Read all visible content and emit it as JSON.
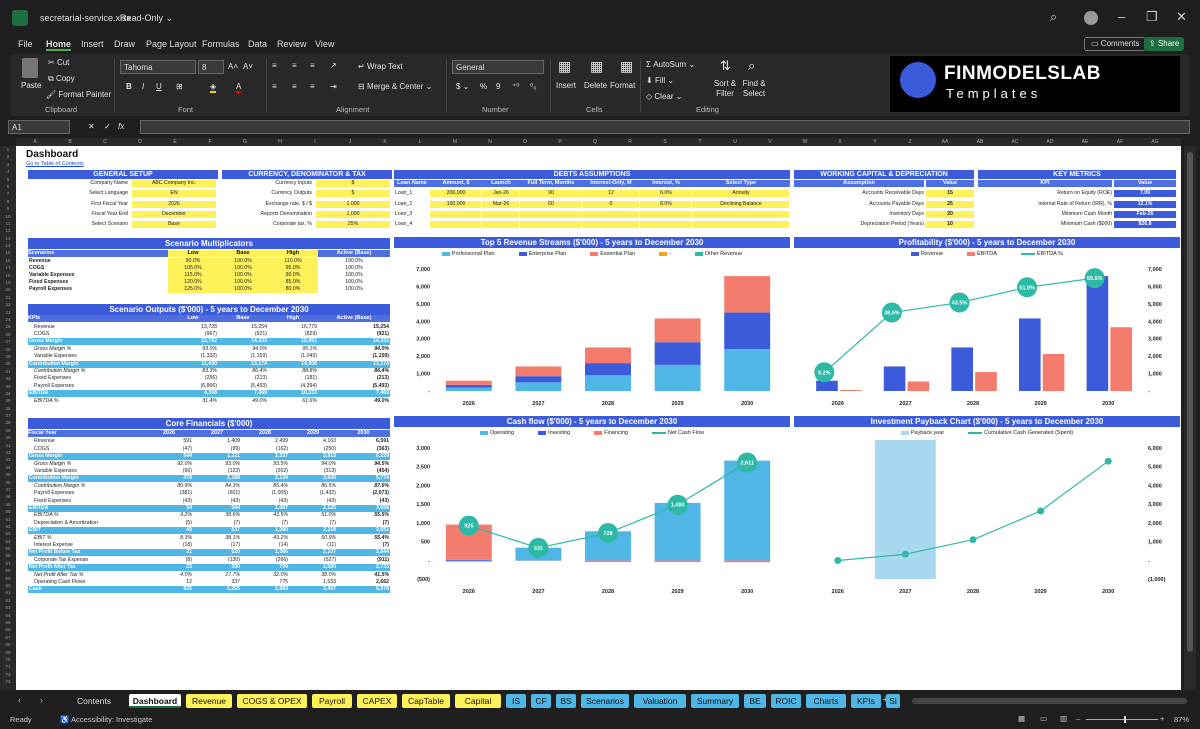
{
  "title": {
    "file": "secretarial-service.xlsx",
    "mode": "Read-Only"
  },
  "menu": [
    "File",
    "Home",
    "Insert",
    "Draw",
    "Page Layout",
    "Formulas",
    "Data",
    "Review",
    "View"
  ],
  "top_buttons": {
    "comments": "Comments",
    "share": "Share"
  },
  "ribbon": {
    "paste": "Paste",
    "cut": "Cut",
    "copy": "Copy",
    "format_painter": "Format Painter",
    "clipboard": "Clipboard",
    "font_name": "Tahoma",
    "font_size": "8",
    "font": "Font",
    "wrap": "Wrap Text",
    "merge": "Merge & Center",
    "alignment": "Alignment",
    "number_format": "General",
    "number": "Number",
    "insert": "Insert",
    "delete": "Delete",
    "format": "Format",
    "cells": "Cells",
    "autosum": "AutoSum",
    "fill": "Fill",
    "clear": "Clear",
    "sort": "Sort & Filter",
    "find": "Find & Select",
    "editing": "Editing"
  },
  "logo": {
    "name": "FINMODELSLAB",
    "sub": "Templates"
  },
  "namebox": "A1",
  "sheet": {
    "title": "Dashboard",
    "toc": "Go to Table of Contents",
    "general": {
      "header": "GENERAL SETUP",
      "rows": [
        [
          "Company Name",
          "ABC Company Inc."
        ],
        [
          "Select Language",
          "EN"
        ],
        [
          "First Fiscal Year",
          "2026"
        ],
        [
          "Fiscal Year End",
          "December"
        ],
        [
          "Select Scenario",
          "Base"
        ]
      ]
    },
    "currency": {
      "header": "CURRENCY, DENOMINATOR & TAX",
      "rows": [
        [
          "Currency Inputs",
          "$"
        ],
        [
          "Currency Outputs",
          "$"
        ],
        [
          "Exchange rate, $ / $",
          "1.000"
        ],
        [
          "Reports Denomination",
          "1,000"
        ],
        [
          "Corporate tax, %",
          "25%"
        ]
      ]
    },
    "debts": {
      "header": "DEBTS ASSUMPTIONS",
      "cols": [
        "Loan Name",
        "Amount, $",
        "Launch",
        "Full Term, Months",
        "Interest-Only, M",
        "Interest, %",
        "Select Type"
      ],
      "rows": [
        [
          "Loan_1",
          "200,000",
          "Jan-26",
          "90",
          "12",
          "6.0%",
          "Annuity"
        ],
        [
          "Loan_2",
          "100,000",
          "Mar-26",
          "60",
          "0",
          "8.0%",
          "Declining Balance"
        ],
        [
          "Loan_3",
          "",
          "",
          "",
          "",
          "",
          ""
        ],
        [
          "Loan_4",
          "",
          "",
          "",
          "",
          "",
          ""
        ]
      ]
    },
    "wc": {
      "header": "WORKING CAPITAL & DEPRECIATION",
      "cols": [
        "Assumption",
        "Value"
      ],
      "rows": [
        [
          "Accounts Receivable Days",
          "15"
        ],
        [
          "Accounts Payable Days",
          "25"
        ],
        [
          "Inventory Days",
          "20"
        ],
        [
          "Depreciation Period (Years)",
          "10"
        ]
      ]
    },
    "kpi": {
      "header": "KEY METRICS",
      "cols": [
        "KPI",
        "Value"
      ],
      "rows": [
        [
          "Return on Equity (ROE)",
          "7.09"
        ],
        [
          "Internal Rate of Return (IRR), %",
          "12.1%"
        ],
        [
          "Minimum Cash Month",
          "Feb-26"
        ],
        [
          "Minimum Cash ($000)",
          "826.8"
        ]
      ]
    },
    "multipliers": {
      "header": "Scenario Multiplicators",
      "cols": [
        "Scenarios",
        "Low",
        "Base",
        "High",
        "Active (Base)"
      ],
      "rows": [
        [
          "Revenue",
          "90.0%",
          "100.0%",
          "110.0%",
          "100.0%"
        ],
        [
          "COGS",
          "105.0%",
          "100.0%",
          "95.0%",
          "100.0%"
        ],
        [
          "Variable Expenses",
          "115.0%",
          "100.0%",
          "90.0%",
          "100.0%"
        ],
        [
          "Fixed Expenses",
          "120.0%",
          "100.0%",
          "85.0%",
          "100.0%"
        ],
        [
          "Payroll Expenses",
          "125.0%",
          "100.0%",
          "80.0%",
          "100.0%"
        ]
      ]
    },
    "outputs": {
      "header": "Scenario Outputs ($'000) - 5 years to December 2030",
      "cols": [
        "KPIs",
        "Low",
        "Base",
        "High",
        "Active (Base)"
      ],
      "rows": [
        [
          "Revenue",
          "13,728",
          "15,254",
          "16,779",
          "15,254"
        ],
        [
          "COGS",
          "(967)",
          "(921)",
          "(829)",
          "(921)"
        ],
        [
          "Gross Margin",
          "12,762",
          "14,333",
          "15,951",
          "14,333"
        ],
        [
          "Gross Margin %",
          "93.0%",
          "94.0%",
          "95.1%",
          "94.0%"
        ],
        [
          "Variable Expenses",
          "(1,332)",
          "(1,159)",
          "(1,043)",
          "(1,159)"
        ],
        [
          "Contribution Margin",
          "11,430",
          "13,174",
          "14,908",
          "13,174"
        ],
        [
          "Contribution Margin %",
          "83.3%",
          "86.4%",
          "88.8%",
          "86.4%"
        ],
        [
          "Fixed Expenses",
          "(256)",
          "(213)",
          "(181)",
          "(213)"
        ],
        [
          "Payroll Expenses",
          "(6,866)",
          "(5,493)",
          "(4,394)",
          "(5,493)"
        ],
        [
          "EBITDA",
          "4,308",
          "7,469",
          "10,333",
          "7,469"
        ],
        [
          "EBITDA %",
          "31.4%",
          "49.0%",
          "61.6%",
          "49.0%"
        ]
      ]
    },
    "core": {
      "header": "Core Financials ($'000)",
      "cols": [
        "Fiscal Year",
        "2026",
        "2027",
        "2028",
        "2029",
        "2030"
      ],
      "rows": [
        [
          "Revenue",
          "591",
          "1,409",
          "2,499",
          "4,163",
          "6,591"
        ],
        [
          "COGS",
          "(47)",
          "(99)",
          "(162)",
          "(250)",
          "(363)"
        ],
        [
          "Gross Margin",
          "544",
          "1,311",
          "2,337",
          "3,913",
          "6,229"
        ],
        [
          "Gross Margin %",
          "92.0%",
          "93.0%",
          "93.5%",
          "94.0%",
          "94.5%"
        ],
        [
          "Variable Expenses",
          "(66)",
          "(123)",
          "(202)",
          "(313)",
          "(454)"
        ],
        [
          "Contribution Margin",
          "478",
          "1,188",
          "2,134",
          "3,600",
          "5,774"
        ],
        [
          "Contribution Margin %",
          "80.9%",
          "84.3%",
          "85.4%",
          "86.5%",
          "87.6%"
        ],
        [
          "Payroll Expenses",
          "(381)",
          "(601)",
          "(1,005)",
          "(1,432)",
          "(2,073)"
        ],
        [
          "Fixed Expenses",
          "(43)",
          "(43)",
          "(43)",
          "(43)",
          "(43)"
        ],
        [
          "EBITDA",
          "54",
          "544",
          "1,087",
          "2,125",
          "3,658"
        ],
        [
          "EBITDA %",
          "9.2%",
          "38.6%",
          "43.5%",
          "51.0%",
          "55.5%"
        ],
        [
          "Depreciation & Amortization",
          "(5)",
          "(7)",
          "(7)",
          "(7)",
          "(7)"
        ],
        [
          "EBIT",
          "49",
          "537",
          "1,080",
          "2,118",
          "3,651"
        ],
        [
          "EBIT %",
          "8.3%",
          "38.1%",
          "43.2%",
          "50.9%",
          "55.4%"
        ],
        [
          "Interest Expense",
          "(18)",
          "(17)",
          "(14)",
          "(11)",
          "(7)"
        ],
        [
          "Net Profit Before Tax",
          "31",
          "520",
          "1,066",
          "2,107",
          "3,644"
        ],
        [
          "Corporate Tax Expense",
          "(8)",
          "(130)",
          "(266)",
          "(527)",
          "(911)"
        ],
        [
          "Net Profit After Tax",
          "23",
          "390",
          "799",
          "1,580",
          "2,733"
        ],
        [
          "Net Profit After Tax %",
          "4.0%",
          "27.7%",
          "32.0%",
          "38.0%",
          "41.5%"
        ],
        [
          "Operating Cash Flows",
          "12",
          "337",
          "775",
          "1,533",
          "2,662"
        ],
        [
          "Cash",
          "925",
          "1,255",
          "1,983",
          "3,467",
          "6,078"
        ]
      ]
    }
  },
  "chart_data": [
    {
      "type": "bar",
      "title": "Top 5 Revenue Streams ($'000) - 5 years to December 2030",
      "categories": [
        "2026",
        "2027",
        "2028",
        "2029",
        "2030"
      ],
      "series": [
        {
          "name": "Professional Plan",
          "color": "#4fb6e6",
          "values": [
            200,
            500,
            900,
            1500,
            2400
          ]
        },
        {
          "name": "Enterprise Plan",
          "color": "#3b5bdb",
          "values": [
            150,
            350,
            700,
            1300,
            2100
          ]
        },
        {
          "name": "Essential Plan",
          "color": "#f47c6c",
          "values": [
            241,
            559,
            899,
            1363,
            2091
          ]
        },
        {
          "name": "-",
          "color": "#f7a11a",
          "values": [
            0,
            0,
            0,
            0,
            0
          ]
        },
        {
          "name": "Other Revenue",
          "color": "#2eb8a6",
          "values": [
            0,
            0,
            0,
            0,
            0
          ]
        }
      ],
      "ylim": [
        0,
        7000
      ],
      "yticks": [
        "7,000",
        "6,000",
        "5,000",
        "4,000",
        "3,000",
        "2,000",
        "1,000",
        "-"
      ]
    },
    {
      "type": "bar",
      "title": "Profitability ($'000) - 5 years to December 2030",
      "categories": [
        "2026",
        "2027",
        "2028",
        "2029",
        "2030"
      ],
      "series": [
        {
          "name": "Revenue",
          "color": "#3b5bdb",
          "values": [
            591,
            1409,
            2499,
            4163,
            6591
          ]
        },
        {
          "name": "EBITDA",
          "color": "#f47c6c",
          "values": [
            54,
            544,
            1087,
            2125,
            3658
          ]
        },
        {
          "name": "EBITDA %",
          "color": "#2eb8a6",
          "values": [
            9.2,
            38.6,
            43.5,
            51.0,
            55.5
          ],
          "labels": [
            "9.2%",
            "38.6%",
            "43.5%",
            "51.0%",
            "55.5%"
          ]
        }
      ],
      "ylim": [
        0,
        7000
      ],
      "yticks": [
        "7,000",
        "6,000",
        "5,000",
        "4,000",
        "3,000",
        "2,000",
        "1,000",
        "-"
      ]
    },
    {
      "type": "bar",
      "title": "Cash flow ($'000) - 5 years to December 2030",
      "categories": [
        "2026",
        "2027",
        "2028",
        "2029",
        "2030"
      ],
      "series": [
        {
          "name": "Operating",
          "color": "#4fb6e6",
          "values": [
            12,
            337,
            775,
            1533,
            2662
          ]
        },
        {
          "name": "Investing",
          "color": "#3b5bdb",
          "values": [
            -30,
            -10,
            -10,
            -10,
            -10
          ]
        },
        {
          "name": "Financing",
          "color": "#f47c6c",
          "values": [
            943,
            0,
            -37,
            -39,
            -41
          ]
        },
        {
          "name": "Net Cash Flow",
          "color": "#2eb8a6",
          "values": [
            925,
            331,
            728,
            1484,
            2611
          ],
          "labels": [
            "925",
            "331",
            "728",
            "1,484",
            "2,611"
          ]
        }
      ],
      "ylim": [
        -500,
        3000
      ],
      "yticks": [
        "3,000",
        "2,500",
        "2,000",
        "1,500",
        "1,000",
        "500",
        "-",
        "(500)"
      ]
    },
    {
      "type": "line",
      "title": "Investment Payback Chart ($'000) - 5 years to December 2030",
      "categories": [
        "2026",
        "2027",
        "2028",
        "2029",
        "2030"
      ],
      "series": [
        {
          "name": "Payback year",
          "color": "#a8d8f0",
          "values": [
            0,
            1,
            0,
            0,
            0
          ]
        },
        {
          "name": "Cumulative Cash Generated (Spent)",
          "color": "#2eb8a6",
          "values": [
            -12,
            325,
            1100,
            2633,
            5295
          ]
        }
      ],
      "ylim": [
        -1000,
        6000
      ],
      "yticks": [
        "6,000",
        "5,000",
        "4,000",
        "3,000",
        "2,000",
        "1,000",
        "-",
        "(1,000)"
      ]
    }
  ],
  "tabs": [
    {
      "name": "Contents",
      "color": ""
    },
    {
      "name": "Dashboard",
      "color": "#fff"
    },
    {
      "name": "Revenue",
      "color": "#fff15a"
    },
    {
      "name": "COGS & OPEX",
      "color": "#fff15a"
    },
    {
      "name": "Payroll",
      "color": "#fff15a"
    },
    {
      "name": "CAPEX",
      "color": "#fff15a"
    },
    {
      "name": "CapTable",
      "color": "#fff15a"
    },
    {
      "name": "Capital",
      "color": "#fff15a"
    },
    {
      "name": "IS",
      "color": "#4fb6e6"
    },
    {
      "name": "CF",
      "color": "#4fb6e6"
    },
    {
      "name": "BS",
      "color": "#4fb6e6"
    },
    {
      "name": "Scenarios",
      "color": "#4fb6e6"
    },
    {
      "name": "Valuation",
      "color": "#4fb6e6"
    },
    {
      "name": "Summary",
      "color": "#4fb6e6"
    },
    {
      "name": "BE",
      "color": "#4fb6e6"
    },
    {
      "name": "ROIC",
      "color": "#4fb6e6"
    },
    {
      "name": "Charts",
      "color": "#4fb6e6"
    },
    {
      "name": "KPIs",
      "color": "#4fb6e6"
    },
    {
      "name": "Si",
      "color": "#4fb6e6"
    }
  ],
  "status": {
    "ready": "Ready",
    "accessibility": "Accessibility: Investigate",
    "zoom": "87%"
  }
}
